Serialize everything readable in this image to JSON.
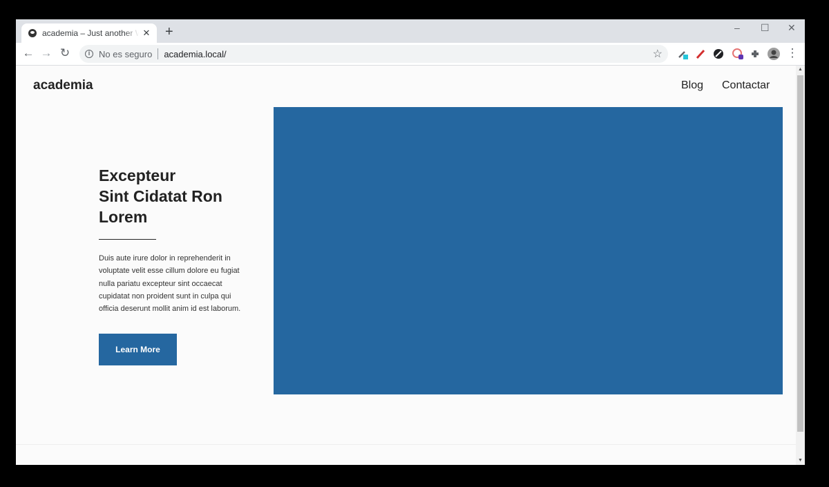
{
  "browser": {
    "tab_title": "academia – Just another WordPress site",
    "tab_close": "✕",
    "new_tab": "+",
    "window_controls": {
      "minimize": "–",
      "maximize": "☐",
      "close": "✕"
    },
    "nav": {
      "back": "←",
      "forward": "→",
      "reload": "↻"
    },
    "security_label": "No es seguro",
    "url": "academia.local/",
    "bookmark_icon": "☆",
    "menu_icon": "⋮"
  },
  "site": {
    "title": "academia",
    "menu": [
      "Blog",
      "Contactar"
    ]
  },
  "hero": {
    "heading_line1": "Excepteur",
    "heading_line2": "Sint Cidatat Ron",
    "heading_line3": "Lorem",
    "text": "Duis aute irure dolor in reprehenderit in voluptate velit esse cillum dolore eu fugiat nulla pariatu excepteur sint occaecat cupidatat non proident sunt in culpa qui officia deserunt mollit anim id est laborum.",
    "button_label": "Learn More",
    "accent_color": "#2567a0"
  }
}
